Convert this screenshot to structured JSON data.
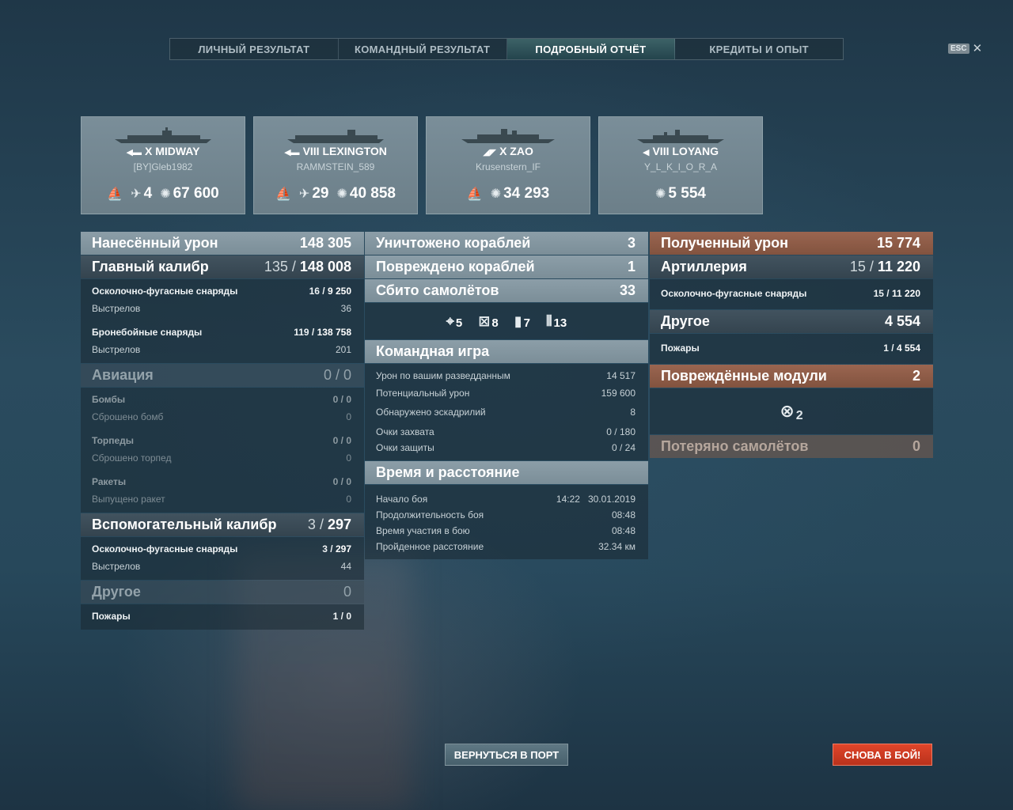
{
  "tabs": [
    {
      "label": "ЛИЧНЫЙ РЕЗУЛЬТАТ",
      "active": false
    },
    {
      "label": "КОМАНДНЫЙ РЕЗУЛЬТАТ",
      "active": false
    },
    {
      "label": "ПОДРОБНЫЙ ОТЧЁТ",
      "active": true
    },
    {
      "label": "КРЕДИТЫ И ОПЫТ",
      "active": false
    }
  ],
  "esc": {
    "key": "ESC",
    "icon": "close-icon"
  },
  "cards": [
    {
      "tier": "X",
      "ship": "MIDWAY",
      "player": "[BY]Gleb1982",
      "planes": "4",
      "damage": "67 600",
      "class_icon": "carrier-icon"
    },
    {
      "tier": "VIII",
      "ship": "LEXINGTON",
      "player": "RAMMSTEIN_589",
      "planes": "29",
      "damage": "40 858",
      "class_icon": "carrier-icon"
    },
    {
      "tier": "X",
      "ship": "ZAO",
      "player": "Krusenstern_IF",
      "planes": "",
      "damage": "34 293",
      "class_icon": "cruiser-icon"
    },
    {
      "tier": "VIII",
      "ship": "LOYANG",
      "player": "Y_L_K_I_O_R_A",
      "planes": "",
      "damage": "5 554",
      "class_icon": "destroyer-icon"
    }
  ],
  "dealt": {
    "title": "Нанесённый урон",
    "total": "148 305",
    "main": {
      "title": "Главный калибр",
      "hits": "135",
      "dmg": "148 008"
    },
    "he_label": "Осколочно-фугасные снаряды",
    "he_hits": "16",
    "he_dmg": "9 250",
    "shots_label": "Выстрелов",
    "he_shots": "36",
    "ap_label": "Бронебойные снаряды",
    "ap_hits": "119",
    "ap_dmg": "138 758",
    "ap_shots": "201",
    "air": {
      "title": "Авиация",
      "value": "0 / 0"
    },
    "bombs_label": "Бомбы",
    "bombs": "0 / 0",
    "bombs_dropped_label": "Сброшено бомб",
    "bombs_dropped": "0",
    "torps_label": "Торпеды",
    "torps": "0 / 0",
    "torps_dropped_label": "Сброшено торпед",
    "torps_dropped": "0",
    "rockets_label": "Ракеты",
    "rockets": "0 / 0",
    "rockets_fired_label": "Выпущено ракет",
    "rockets_fired": "0",
    "secondary": {
      "title": "Вспомогательный калибр",
      "hits": "3",
      "dmg": "297"
    },
    "sec_he_label": "Осколочно-фугасные снаряды",
    "sec_he_hits": "3",
    "sec_he_dmg": "297",
    "sec_shots": "44",
    "other": {
      "title": "Другое",
      "value": "0"
    },
    "fires_label": "Пожары",
    "fires": "1 / 0"
  },
  "middle": {
    "destroyed": {
      "title": "Уничтожено кораблей",
      "value": "3"
    },
    "damaged": {
      "title": "Повреждено кораблей",
      "value": "1"
    },
    "planes": {
      "title": "Сбито самолётов",
      "value": "33"
    },
    "plane_icons": [
      {
        "icon": "crosshair-icon",
        "value": "5"
      },
      {
        "icon": "fighter-icon",
        "value": "8"
      },
      {
        "icon": "bomb-icon",
        "value": "7"
      },
      {
        "icon": "ammo-icon",
        "value": "13"
      }
    ],
    "team": {
      "title": "Командная игра"
    },
    "team_rows": [
      {
        "label": "Урон по вашим разведданным",
        "value": "14 517"
      },
      {
        "label": "Потенциальный урон",
        "value": "159 600"
      },
      {
        "label": "Обнаружено эскадрилий",
        "value": "8"
      },
      {
        "label": "Очки захвата",
        "value": "0 / 180"
      },
      {
        "label": "Очки защиты",
        "value": "0 / 24"
      }
    ],
    "time": {
      "title": "Время и расстояние"
    },
    "time_rows": [
      {
        "label": "Начало боя",
        "value": "14:22   30.01.2019"
      },
      {
        "label": "Продолжительность боя",
        "value": "08:48"
      },
      {
        "label": "Время участия в бою",
        "value": "08:48"
      },
      {
        "label": "Пройденное расстояние",
        "value": "32.34 км"
      }
    ]
  },
  "received": {
    "title": "Полученный урон",
    "total": "15 774",
    "art": {
      "title": "Артиллерия",
      "hits": "15",
      "dmg": "11 220"
    },
    "he_label": "Осколочно-фугасные снаряды",
    "he_hits": "15",
    "he_dmg": "11 220",
    "other": {
      "title": "Другое",
      "value": "4 554"
    },
    "fires_label": "Пожары",
    "fires_hits": "1",
    "fires_dmg": "4 554",
    "modules": {
      "title": "Повреждённые модули",
      "value": "2"
    },
    "module_icon_value": "2",
    "lost": {
      "title": "Потеряно самолётов",
      "value": "0"
    }
  },
  "buttons": {
    "port": "ВЕРНУТЬСЯ В ПОРТ",
    "battle": "СНОВА В БОЙ!"
  }
}
